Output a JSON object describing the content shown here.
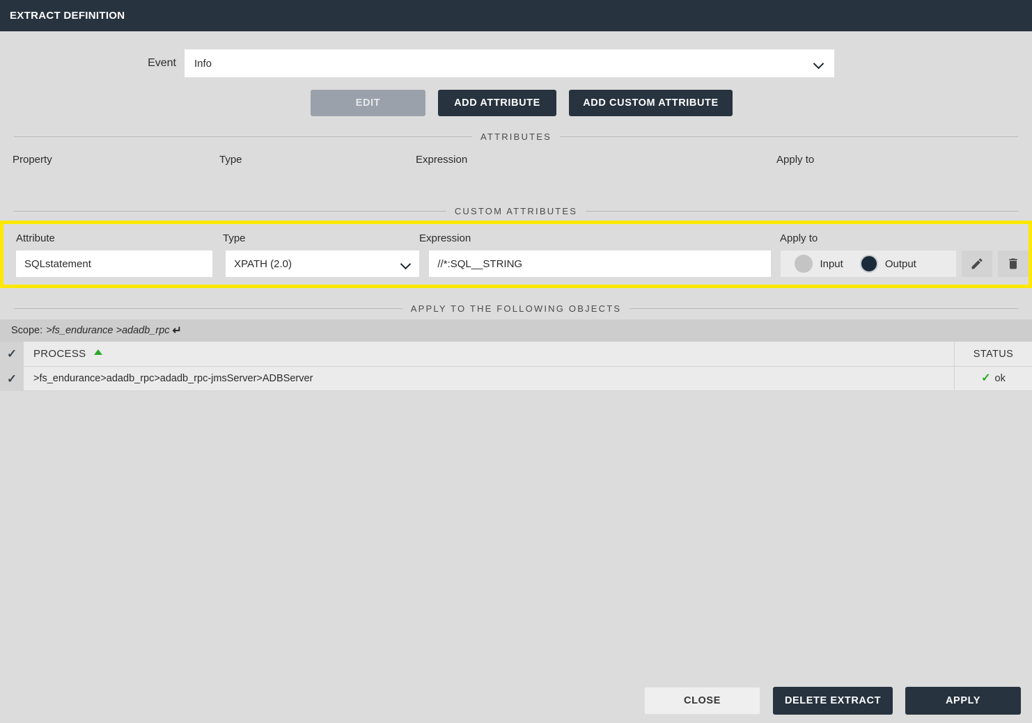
{
  "window": {
    "title": "EXTRACT DEFINITION"
  },
  "event": {
    "label": "Event",
    "value": "Info",
    "chevron_icon": "chevron-down-icon"
  },
  "toolbar": {
    "edit_label": "EDIT",
    "add_attribute_label": "ADD ATTRIBUTE",
    "add_custom_attribute_label": "ADD CUSTOM ATTRIBUTE"
  },
  "attributes_section": {
    "title": "ATTRIBUTES",
    "columns": [
      "Property",
      "Type",
      "Expression",
      "Apply to"
    ],
    "rows": []
  },
  "custom_attributes_section": {
    "title": "CUSTOM ATTRIBUTES",
    "columns": [
      "Attribute",
      "Type",
      "Expression",
      "Apply to"
    ],
    "row": {
      "attribute": "SQLstatement",
      "type": "XPATH (2.0)",
      "expression": "//*:SQL__STRING",
      "apply_to": {
        "input_label": "Input",
        "output_label": "Output",
        "selected": "Output"
      },
      "edit_icon": "pencil-icon",
      "delete_icon": "trash-icon"
    }
  },
  "objects_section": {
    "title": "APPLY TO THE FOLLOWING OBJECTS",
    "scope_label": "Scope:",
    "scope_path": ">fs_endurance >adadb_rpc",
    "scope_enter_icon": "↵",
    "table": {
      "columns": [
        "PROCESS",
        "STATUS"
      ],
      "sort_icon": "sort-ascending-icon",
      "rows": [
        {
          "checked": true,
          "process": ">fs_endurance>adadb_rpc>adadb_rpc-jmsServer>ADBServer",
          "status": "ok"
        }
      ]
    }
  },
  "footer": {
    "close_label": "CLOSE",
    "delete_extract_label": "DELETE EXTRACT",
    "apply_label": "APPLY"
  },
  "colors": {
    "header_bar": "#27333f",
    "accent_dark": "#27333f",
    "highlight": "#ffe800",
    "status_ok": "#1eae1e",
    "disabled_button": "#9aa1aa"
  }
}
